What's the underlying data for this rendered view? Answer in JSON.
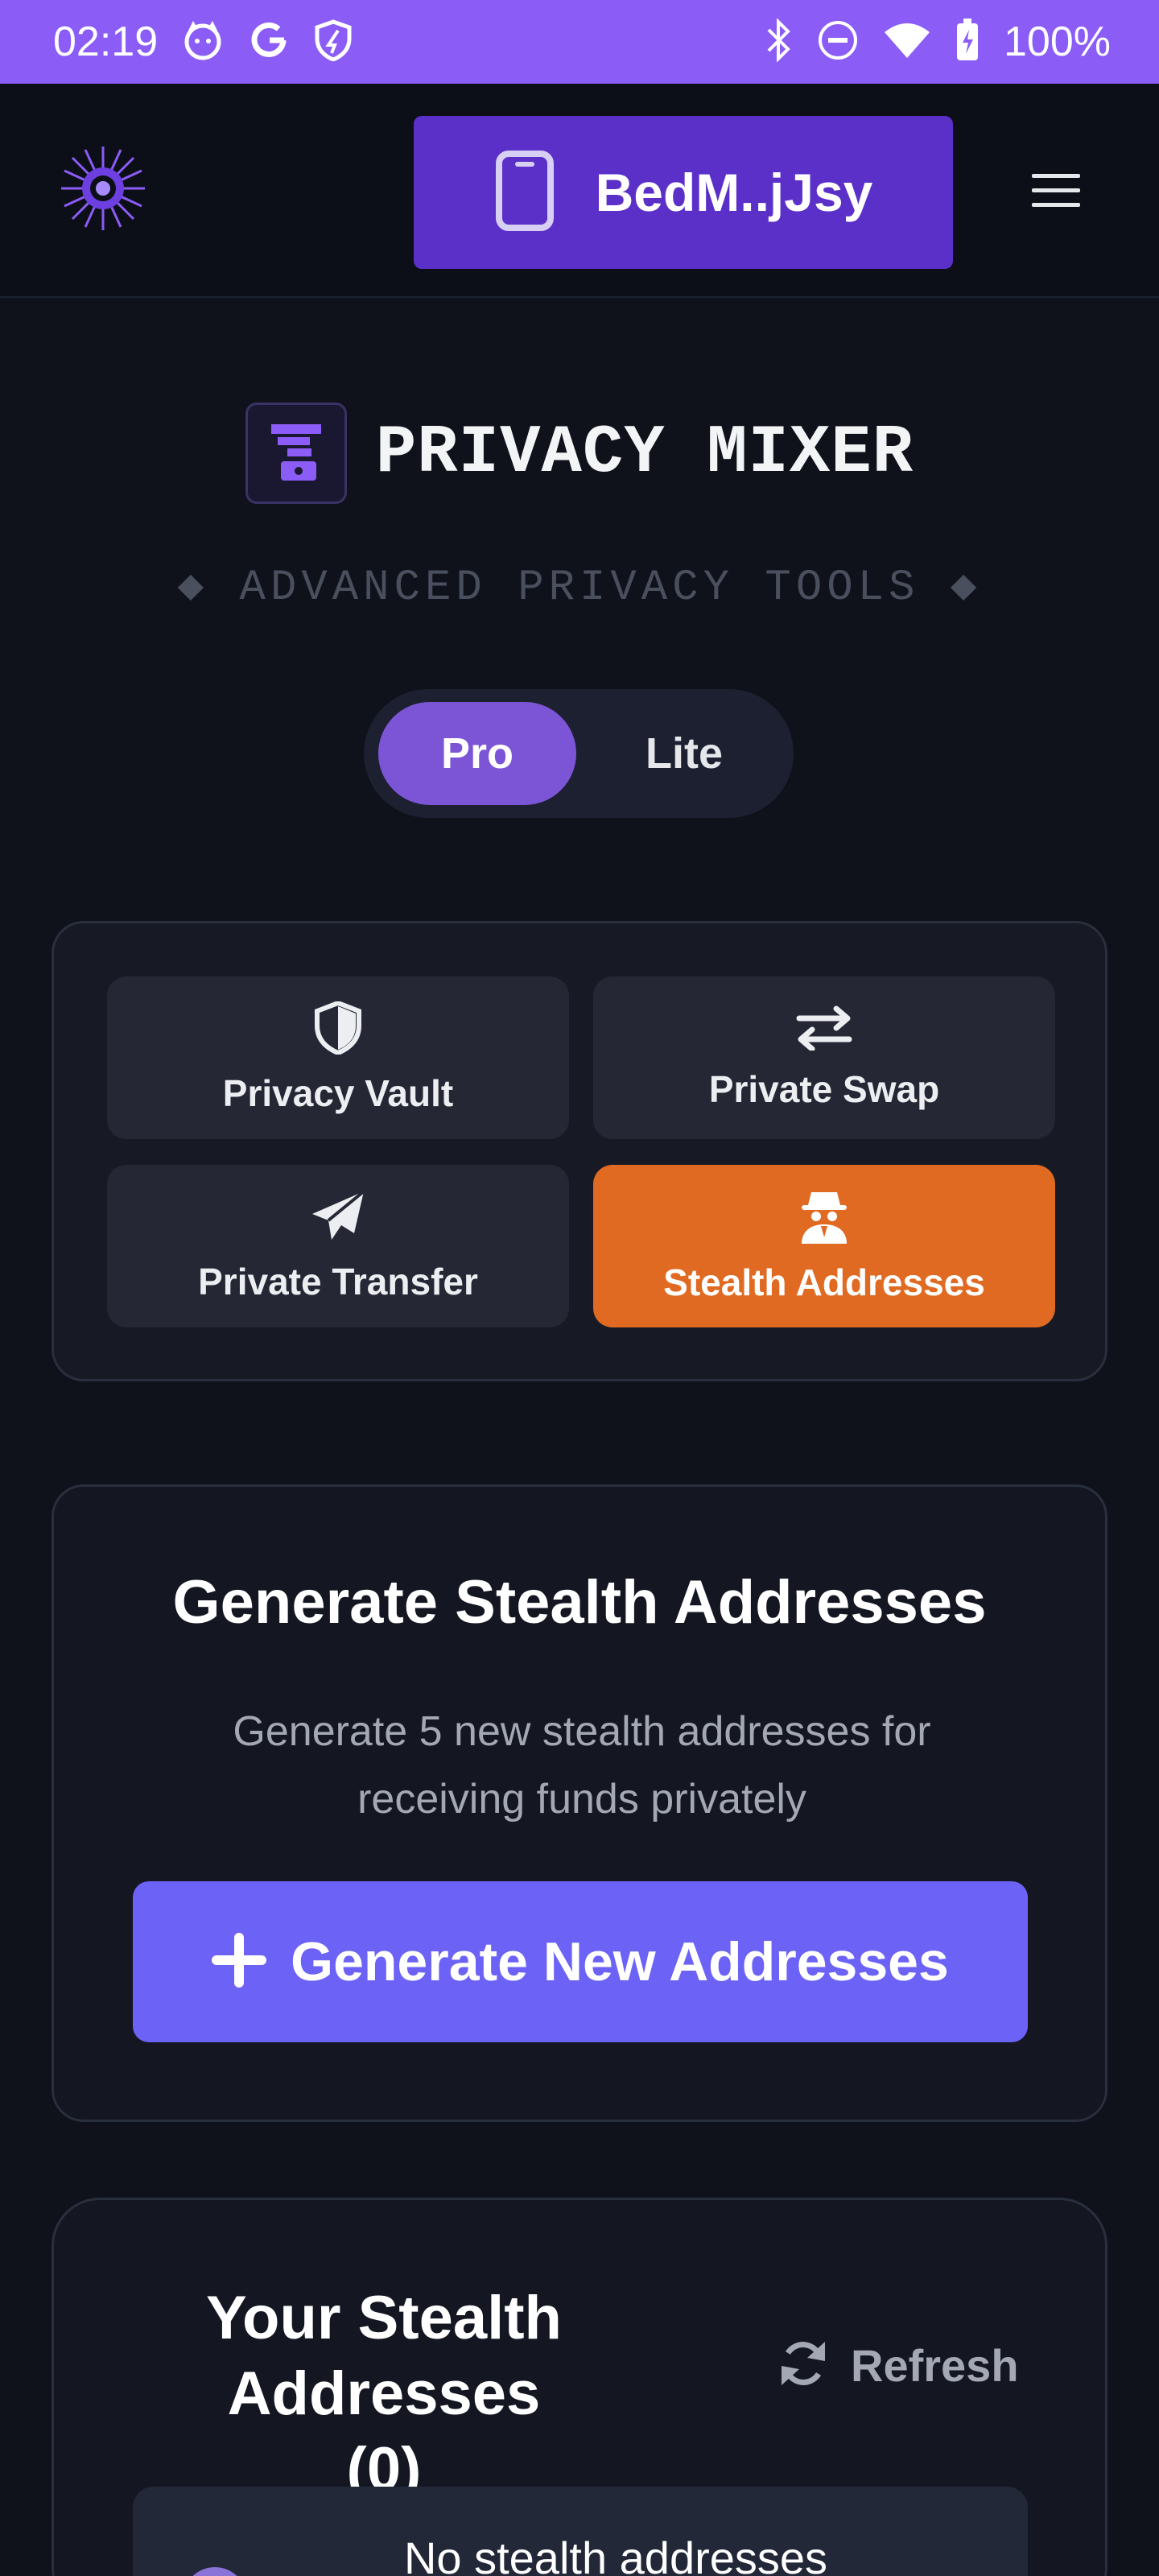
{
  "status_bar": {
    "time": "02:19",
    "battery": "100%",
    "left_icons": [
      "cat-app-icon",
      "google-icon",
      "shield-icon"
    ],
    "right_icons": [
      "bluetooth-icon",
      "do-not-disturb-icon",
      "wifi-icon",
      "battery-icon"
    ]
  },
  "header": {
    "wallet_label": "BedM..jJsy",
    "wallet_icon": "phone-icon",
    "menu_icon": "hamburger-menu-icon"
  },
  "page": {
    "title": "PRIVACY MIXER",
    "subtitle": "◆ ADVANCED PRIVACY TOOLS ◆"
  },
  "mode_toggle": {
    "options": [
      "Pro",
      "Lite"
    ],
    "selected": "Pro"
  },
  "tabs": [
    {
      "label": "Privacy Vault",
      "icon": "shield-icon"
    },
    {
      "label": "Private Swap",
      "icon": "swap-arrows-icon"
    },
    {
      "label": "Private Transfer",
      "icon": "paper-plane-icon"
    },
    {
      "label": "Stealth Addresses",
      "icon": "spy-icon",
      "active": true
    }
  ],
  "generate": {
    "title": "Generate Stealth Addresses",
    "description": "Generate 5 new stealth addresses for receiving funds privately",
    "button_label": "Generate New Addresses"
  },
  "addresses": {
    "title": "Your Stealth Addresses (0)",
    "refresh_label": "Refresh",
    "empty_text": "No stealth addresses"
  },
  "colors": {
    "status_bar": "#8b5cf6",
    "wallet_button": "#5b30c9",
    "toggle_active": "#7c55d6",
    "active_tab": "#e06a22",
    "primary_button": "#6c63f6",
    "background": "#0f121b"
  }
}
